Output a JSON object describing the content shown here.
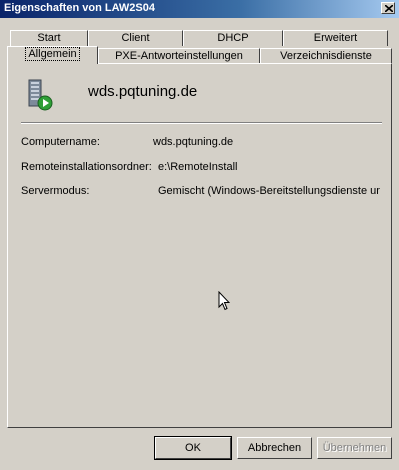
{
  "window": {
    "title": "Eigenschaften von LAW2S04"
  },
  "tabs_row1": [
    "Start",
    "Client",
    "DHCP",
    "Erweitert"
  ],
  "tabs_row2": [
    "Allgemein",
    "PXE-Antworteinstellungen",
    "Verzeichnisdienste"
  ],
  "active_tab": "Allgemein",
  "server": {
    "name": "wds.pqtuning.de",
    "icon": "server-icon"
  },
  "fields": [
    {
      "label": "Computername:",
      "value": "wds.pqtuning.de"
    },
    {
      "label": "Remoteinstallationsordner:",
      "value": "e:\\RemoteInstall"
    },
    {
      "label": "Servermodus:",
      "value": "Gemischt (Windows-Bereitstellungsdienste und"
    }
  ],
  "buttons": {
    "ok": "OK",
    "cancel": "Abbrechen",
    "apply": "Übernehmen"
  }
}
